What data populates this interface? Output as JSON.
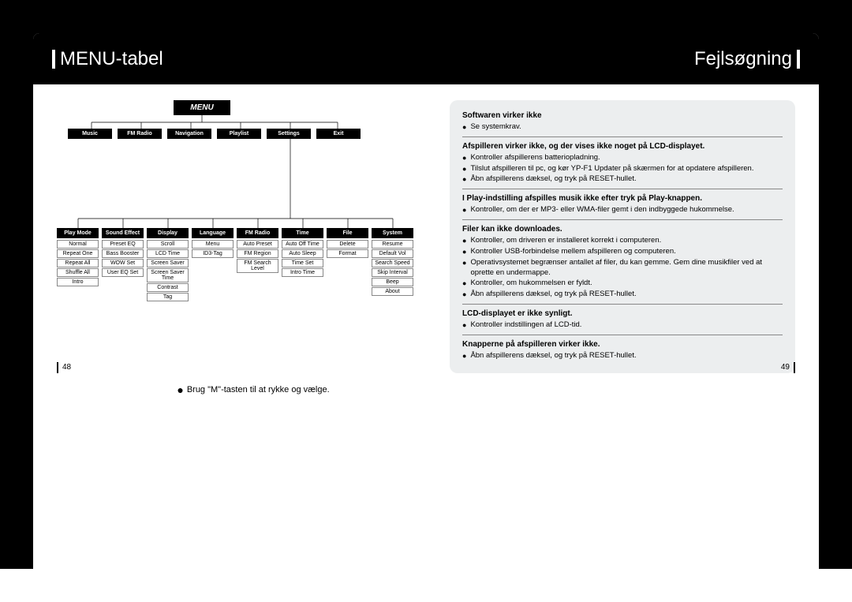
{
  "header": {
    "left_title": "MENU-tabel",
    "right_title": "Fejlsøgning"
  },
  "menu_tree": {
    "root": "MENU",
    "row1": [
      "Music",
      "FM Radio",
      "Navigation",
      "Playlist",
      "Settings",
      "Exit"
    ],
    "row2_heads": [
      "Play Mode",
      "Sound Effect",
      "Display",
      "Language",
      "FM Radio",
      "Time",
      "File",
      "System"
    ],
    "row2_cols": {
      "play_mode": [
        "Normal",
        "Repeat One",
        "Repeat All",
        "Shuffle All",
        "Intro"
      ],
      "sound_effect": [
        "Preset EQ",
        "Bass Booster",
        "WOW Set",
        "User EQ Set"
      ],
      "display": [
        "Scroll",
        "LCD Time",
        "Screen Saver",
        "Screen Saver Time",
        "Contrast",
        "Tag"
      ],
      "language": [
        "Menu",
        "ID3-Tag"
      ],
      "fm_radio": [
        "Auto Preset",
        "FM Region",
        "FM Search Level"
      ],
      "time": [
        "Auto Off Time",
        "Auto Sleep",
        "Time Set",
        "Intro Time"
      ],
      "file": [
        "Delete",
        "Format"
      ],
      "system": [
        "Resume",
        "Default Vol",
        "Search Speed",
        "Skip Interval",
        "Beep",
        "About"
      ]
    }
  },
  "hint_text": "Brug \"M\"-tasten til at rykke og vælge.",
  "troubleshooting": {
    "sections": [
      {
        "title": "Softwaren virker ikke",
        "items": [
          "Se systemkrav."
        ]
      },
      {
        "title": "Afspilleren virker ikke, og der vises ikke noget på LCD-displayet.",
        "items": [
          "Kontroller afspillerens batteriopladning.",
          "Tilslut afspilleren til pc, og kør YP-F1 Updater på skærmen for at opdatere afspilleren.",
          "Åbn afspillerens dæksel, og tryk på RESET-hullet."
        ]
      },
      {
        "title": "I Play-indstilling afspilles musik ikke efter tryk på Play-knappen.",
        "items": [
          "Kontroller, om der er MP3- eller WMA-filer gemt i den indbyggede hukommelse."
        ]
      },
      {
        "title": "Filer kan ikke downloades.",
        "items": [
          "Kontroller, om driveren er installeret korrekt i computeren.",
          "Kontroller USB-forbindelse mellem afspilleren og computeren.",
          "Operativsystemet begrænser antallet af filer, du kan gemme. Gem dine musikfiler ved at oprette en undermappe.",
          "Kontroller, om hukommelsen er fyldt.",
          "Åbn afspillerens dæksel, og tryk på RESET-hullet."
        ]
      },
      {
        "title": "LCD-displayet er ikke synligt.",
        "items": [
          "Kontroller indstillingen af LCD-tid."
        ]
      },
      {
        "title": "Knapperne på afspilleren virker ikke.",
        "items": [
          "Åbn afspillerens dæksel, og tryk på RESET-hullet."
        ]
      }
    ]
  },
  "page_numbers": {
    "left": "48",
    "right": "49"
  }
}
